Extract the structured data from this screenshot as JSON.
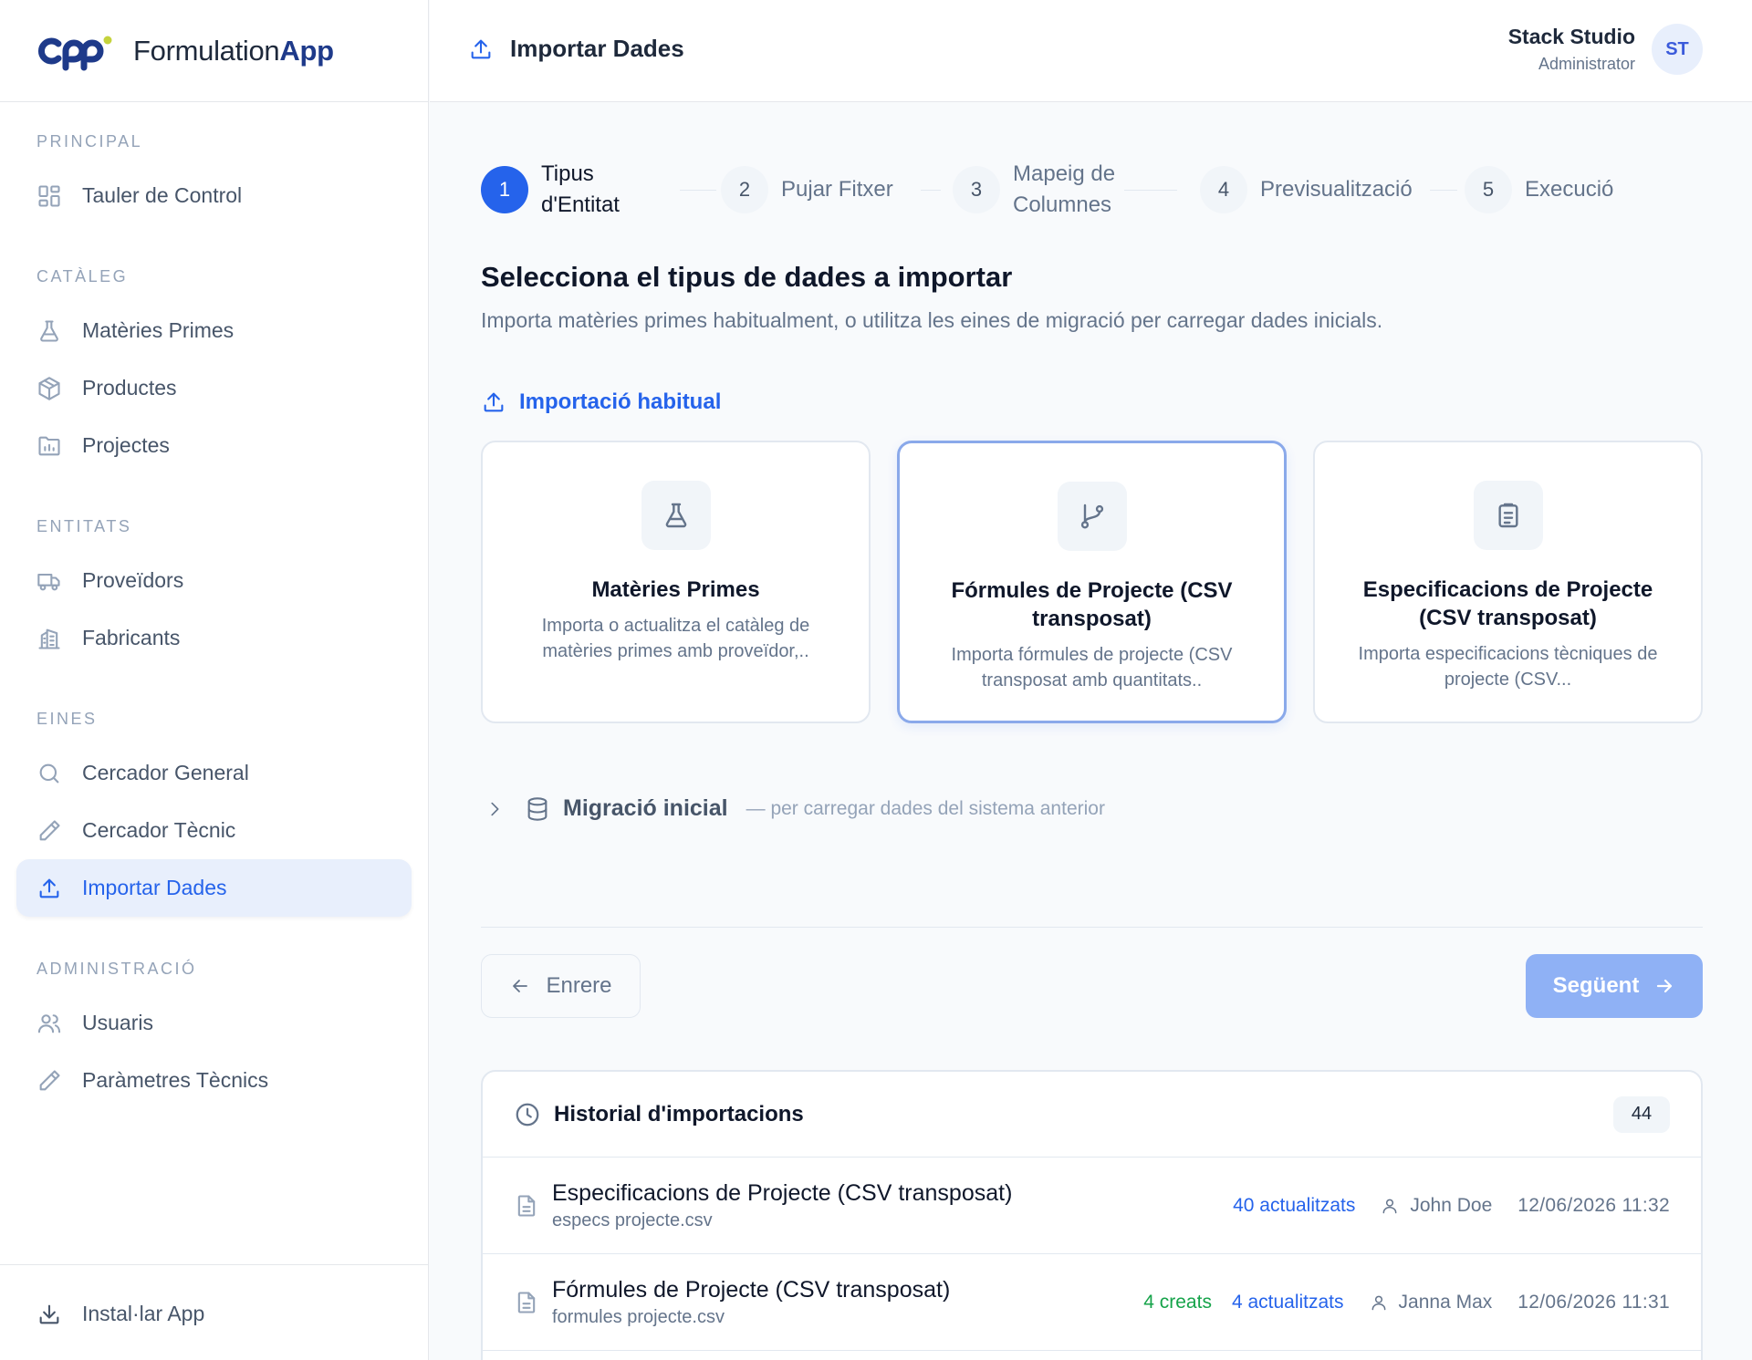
{
  "brand": {
    "name_prefix": "Formulation",
    "name_suffix": "App"
  },
  "header": {
    "title": "Importar Dades"
  },
  "user": {
    "name": "Stack Studio",
    "role": "Administrator",
    "initials": "ST"
  },
  "sidebar": {
    "sections": [
      {
        "title": "PRINCIPAL",
        "items": [
          {
            "label": "Tauler de Control",
            "icon": "dashboard-icon"
          }
        ]
      },
      {
        "title": "CATÀLEG",
        "items": [
          {
            "label": "Matèries Primes",
            "icon": "flask-icon"
          },
          {
            "label": "Productes",
            "icon": "box-icon"
          },
          {
            "label": "Projectes",
            "icon": "folder-chart-icon"
          }
        ]
      },
      {
        "title": "ENTITATS",
        "items": [
          {
            "label": "Proveïdors",
            "icon": "truck-icon"
          },
          {
            "label": "Fabricants",
            "icon": "building-icon"
          }
        ]
      },
      {
        "title": "EINES",
        "items": [
          {
            "label": "Cercador General",
            "icon": "search-icon"
          },
          {
            "label": "Cercador Tècnic",
            "icon": "pencil-icon"
          },
          {
            "label": "Importar Dades",
            "icon": "upload-icon",
            "active": true
          }
        ]
      },
      {
        "title": "ADMINISTRACIÓ",
        "items": [
          {
            "label": "Usuaris",
            "icon": "users-icon"
          },
          {
            "label": "Paràmetres Tècnics",
            "icon": "pencil-icon"
          }
        ]
      }
    ],
    "footer": {
      "label": "Instal·lar App",
      "icon": "download-icon"
    }
  },
  "steps": [
    {
      "num": "1",
      "label": "Tipus d'Entitat",
      "active": true
    },
    {
      "num": "2",
      "label": "Pujar Fitxer"
    },
    {
      "num": "3",
      "label": "Mapeig de Columnes"
    },
    {
      "num": "4",
      "label": "Previsualització"
    },
    {
      "num": "5",
      "label": "Execució"
    }
  ],
  "main": {
    "heading": "Selecciona el tipus de dades a importar",
    "description": "Importa matèries primes habitualment, o utilitza les eines de migració per carregar dades inicials.",
    "regular_section": "Importació habitual",
    "cards": [
      {
        "title": "Matèries Primes",
        "desc": "Importa o actualitza el catàleg de matèries primes amb proveïdor,..",
        "icon": "flask-icon"
      },
      {
        "title": "Fórmules de Projecte (CSV transposat)",
        "desc": "Importa fórmules de projecte (CSV transposat amb quantitats..",
        "icon": "git-branch-icon",
        "selected": true
      },
      {
        "title": "Especificacions de Projecte (CSV transposat)",
        "desc": "Importa especificacions tècniques de projecte (CSV...",
        "icon": "clipboard-icon"
      }
    ],
    "migration": {
      "title": "Migració inicial",
      "subtitle": "— per carregar dades del sistema anterior"
    },
    "back_label": "Enrere",
    "next_label": "Següent"
  },
  "history": {
    "title": "Historial d'importacions",
    "count": "44",
    "rows": [
      {
        "name": "Especificacions de Projecte (CSV transposat)",
        "file": "especs projecte.csv",
        "created": "",
        "updated": "40 actualitzats",
        "user": "John Doe",
        "date": "12/06/2026 11:32"
      },
      {
        "name": "Fórmules de Projecte (CSV transposat)",
        "file": "formules projecte.csv",
        "created": "4 creats",
        "updated": "4 actualitzats",
        "user": "Janna Max",
        "date": "12/06/2026 11:31"
      }
    ]
  },
  "colors": {
    "accent": "#2563eb",
    "brand": "#1e3a8a",
    "success": "#16a34a",
    "next_button": "#8fb1f5"
  }
}
